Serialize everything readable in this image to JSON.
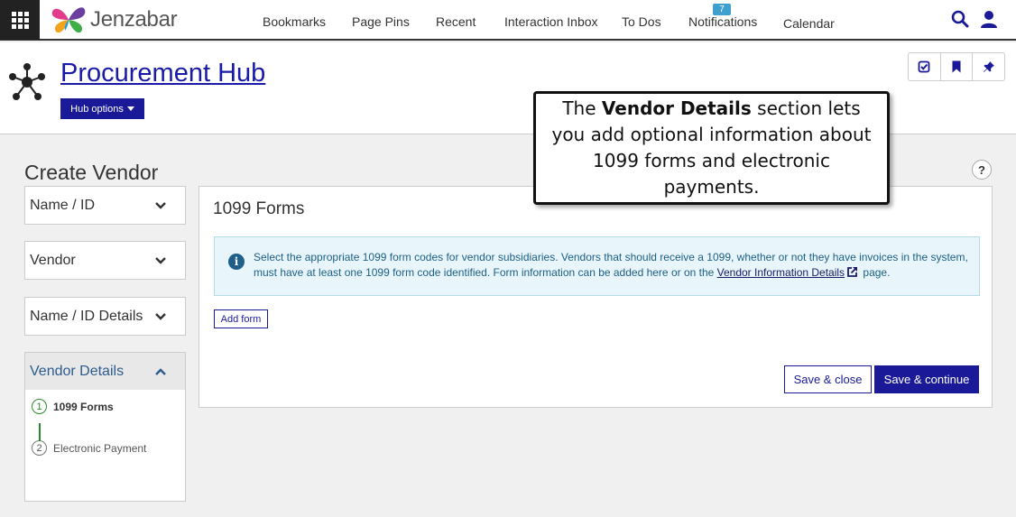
{
  "topnav": {
    "brand": "Jenzabar",
    "items": [
      {
        "label": "Bookmarks"
      },
      {
        "label": "Page Pins"
      },
      {
        "label": "Recent"
      },
      {
        "label": "Interaction Inbox"
      },
      {
        "label": "To Dos"
      },
      {
        "label": "Notifications"
      },
      {
        "label": "Calendar"
      }
    ],
    "notification_count": "7",
    "icons": [
      "apps-grid-icon",
      "search-icon",
      "user-icon"
    ]
  },
  "hub": {
    "title": "Procurement Hub",
    "options_label": "Hub options",
    "actions": [
      "checklist-icon",
      "bookmark-icon",
      "pin-icon"
    ]
  },
  "page": {
    "title": "Create Vendor",
    "help_label": "?"
  },
  "sidebar": {
    "panels": [
      {
        "label": "Name / ID",
        "expanded": false
      },
      {
        "label": "Vendor",
        "expanded": false
      },
      {
        "label": "Name / ID Details",
        "expanded": false
      },
      {
        "label": "Vendor Details",
        "expanded": true
      }
    ],
    "steps": [
      {
        "number": "1",
        "label": "1099 Forms",
        "current": true
      },
      {
        "number": "2",
        "label": "Electronic Payment",
        "current": false
      }
    ]
  },
  "content": {
    "section_title": "1099 Forms",
    "info_text_1": "Select the appropriate 1099 form codes for vendor subsidiaries. Vendors that should receive a 1099, whether or not they have invoices in the system, must have at least one 1099 form code identified. Form information can be added here or on the ",
    "info_link": "Vendor Information Details",
    "info_text_2": " page.",
    "add_form_label": "Add form",
    "save_close_label": "Save & close",
    "save_continue_label": "Save & continue"
  },
  "callout": {
    "prefix": "The ",
    "bold": "Vendor Details",
    "suffix": " section lets you add optional information about 1099 forms and electronic payments."
  },
  "colors": {
    "primary": "#1a1a99",
    "link": "#1a1aa8",
    "info_bg": "#e8f6fb",
    "info_text": "#1d5f86",
    "step_active": "#2a8a2a",
    "badge": "#3fa0d0"
  }
}
